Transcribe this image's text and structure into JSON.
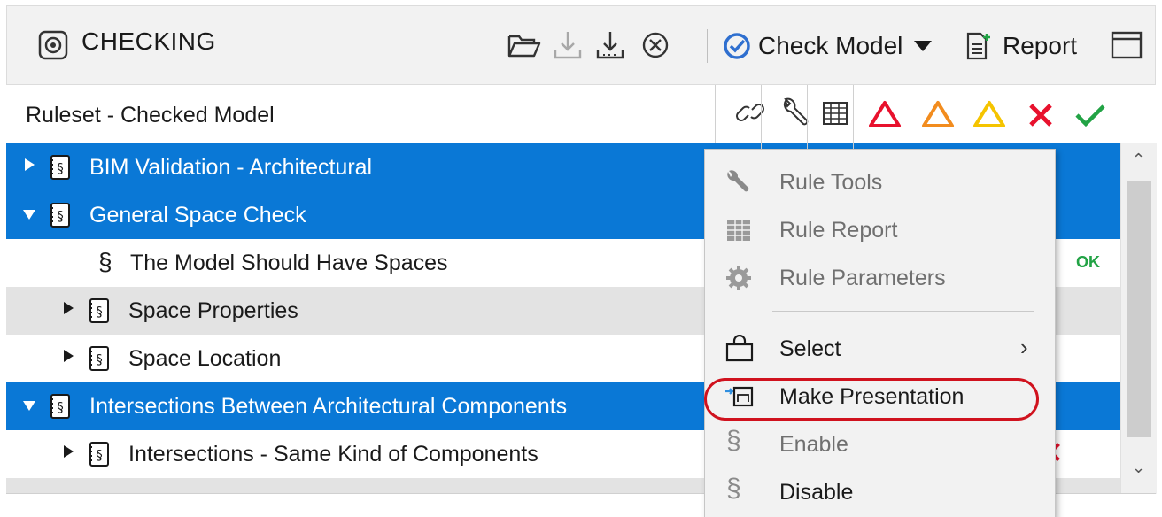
{
  "header": {
    "title": "CHECKING",
    "check_model_label": "Check Model",
    "report_label": "Report"
  },
  "columns": {
    "label": "Ruleset - Checked Model"
  },
  "tree": [
    {
      "label": "BIM Validation - Architectural",
      "selected": true,
      "expanded": false
    },
    {
      "label": "General Space Check",
      "selected": true,
      "expanded": true
    },
    {
      "label": "The Model Should Have Spaces",
      "status": "OK"
    },
    {
      "label": "Space Properties"
    },
    {
      "label": "Space Location"
    },
    {
      "label": "Intersections Between Architectural Components",
      "selected": true,
      "expanded": true
    },
    {
      "label": "Intersections - Same Kind of Components",
      "status": "✕"
    }
  ],
  "context_menu": {
    "items": [
      {
        "label": "Rule Tools",
        "icon": "wrench-icon",
        "enabled": false
      },
      {
        "label": "Rule Report",
        "icon": "table-icon",
        "enabled": false
      },
      {
        "label": "Rule Parameters",
        "icon": "gear-icon",
        "enabled": false
      },
      {
        "label": "Select",
        "icon": "selection-bag-icon",
        "enabled": true,
        "submenu": true
      },
      {
        "label": "Make Presentation",
        "icon": "presentation-icon",
        "enabled": true,
        "highlighted": true
      },
      {
        "label": "Enable",
        "icon": "section-icon",
        "enabled": false
      },
      {
        "label": "Disable",
        "icon": "section-icon",
        "enabled": true
      }
    ]
  },
  "colors": {
    "selection": "#0a78d6",
    "error_red": "#e8112d",
    "warning_orange": "#f28c1e",
    "warning_yellow": "#f5c400",
    "ok_green": "#22a345",
    "accent_check": "#2f6fcf",
    "highlight_ring": "#d0121e"
  }
}
